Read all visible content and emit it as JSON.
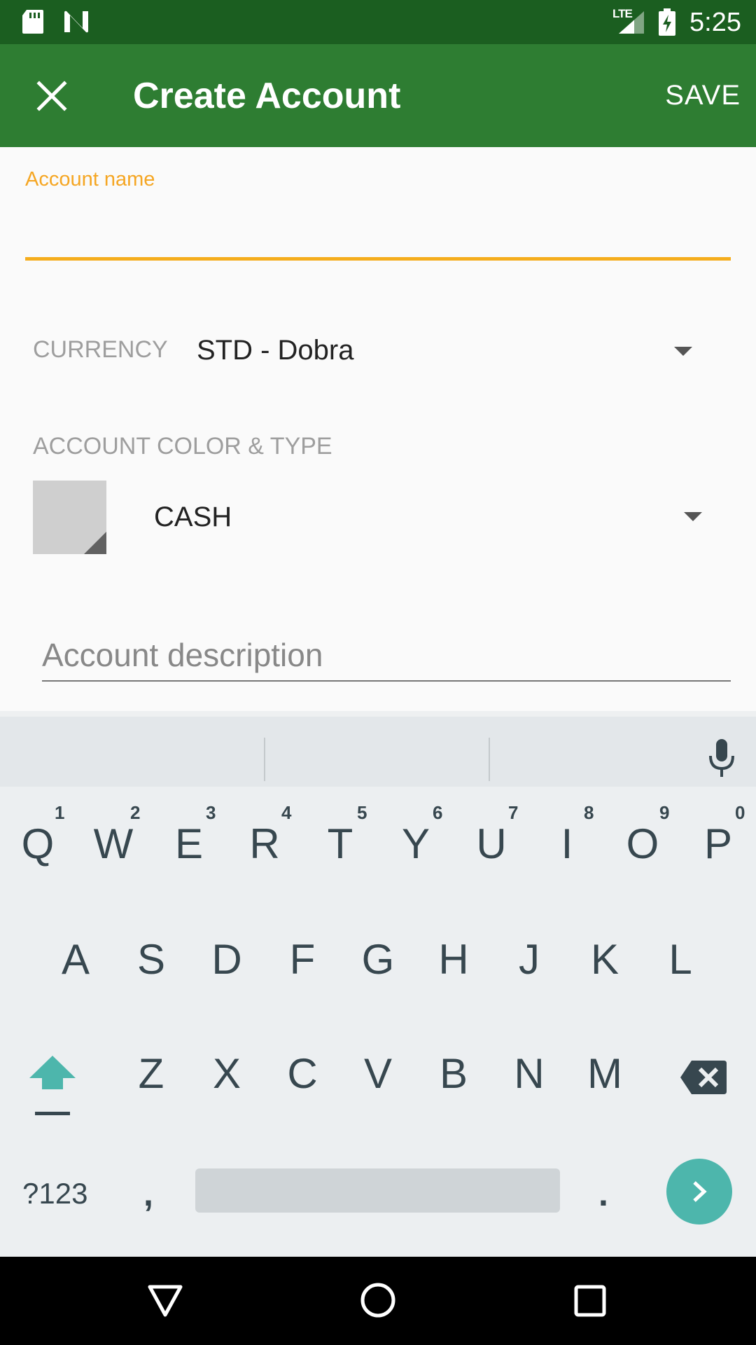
{
  "status_bar": {
    "time": "5:25",
    "network": "LTE",
    "icons": [
      "sd-card-icon",
      "n-icon",
      "signal-icon",
      "battery-charging-icon"
    ]
  },
  "app_bar": {
    "title": "Create Account",
    "save_label": "SAVE",
    "close_icon": "close-icon",
    "background": "#2e7d32"
  },
  "form": {
    "name_label": "Account name",
    "name_value": "",
    "currency_label": "CURRENCY",
    "currency_value": "STD - Dobra",
    "color_type_label": "ACCOUNT COLOR & TYPE",
    "color_swatch": "#cfcfcf",
    "type_value": "CASH",
    "description_placeholder": "Account description",
    "accent_color": "#f5ad1d"
  },
  "keyboard": {
    "row1": [
      "Q",
      "W",
      "E",
      "R",
      "T",
      "Y",
      "U",
      "I",
      "O",
      "P"
    ],
    "row1_hints": [
      "1",
      "2",
      "3",
      "4",
      "5",
      "6",
      "7",
      "8",
      "9",
      "0"
    ],
    "row2": [
      "A",
      "S",
      "D",
      "F",
      "G",
      "H",
      "J",
      "K",
      "L"
    ],
    "row3": [
      "Z",
      "X",
      "C",
      "V",
      "B",
      "N",
      "M"
    ],
    "symbols_label": "?123",
    "comma_label": ",",
    "period_label": ".",
    "enter_color": "#4db6ac"
  }
}
